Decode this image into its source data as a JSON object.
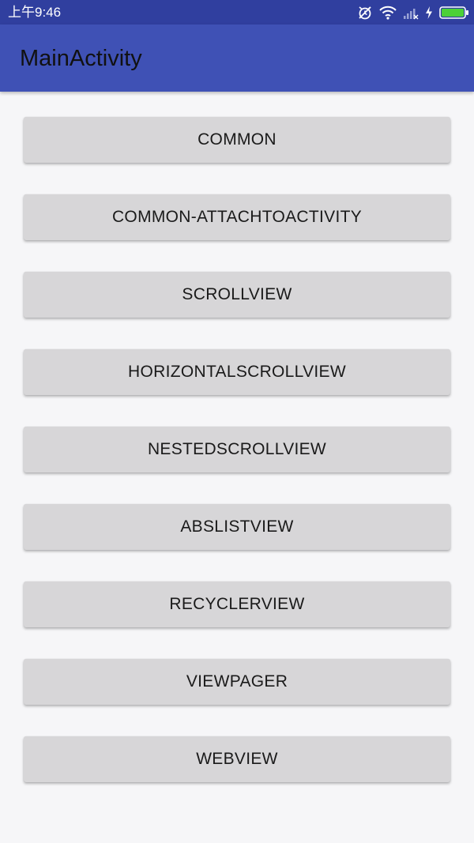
{
  "status_bar": {
    "time": "上午9:46",
    "icons": [
      "alarm-off-icon",
      "wifi-icon",
      "signal-icon",
      "charging-icon",
      "battery-icon"
    ],
    "battery_color": "#4cd137"
  },
  "app_bar": {
    "title": "MainActivity",
    "color": "#3f51b5",
    "status_color": "#303f9f"
  },
  "buttons": [
    {
      "label": "COMMON"
    },
    {
      "label": "COMMON-ATTACHTOACTIVITY"
    },
    {
      "label": "SCROLLVIEW"
    },
    {
      "label": "HORIZONTALSCROLLVIEW"
    },
    {
      "label": "NESTEDSCROLLVIEW"
    },
    {
      "label": "ABSLISTVIEW"
    },
    {
      "label": "RECYCLERVIEW"
    },
    {
      "label": "VIEWPAGER"
    },
    {
      "label": "WEBVIEW"
    }
  ]
}
